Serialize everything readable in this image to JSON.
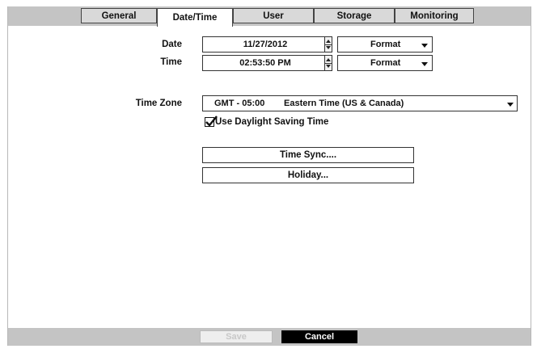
{
  "tabs": [
    {
      "label": "General",
      "active": false
    },
    {
      "label": "Date/Time",
      "active": true
    },
    {
      "label": "User",
      "active": false
    },
    {
      "label": "Storage",
      "active": false
    },
    {
      "label": "Monitoring",
      "active": false
    }
  ],
  "date": {
    "label": "Date",
    "value": "11/27/2012",
    "format_label": "Format"
  },
  "time": {
    "label": "Time",
    "value": "02:53:50 PM",
    "format_label": "Format"
  },
  "timezone": {
    "label": "Time Zone",
    "offset": "GMT - 05:00",
    "name": "Eastern Time (US & Canada)"
  },
  "dst": {
    "label": "Use Daylight Saving Time",
    "checked": true
  },
  "buttons": {
    "time_sync": "Time Sync....",
    "holiday": "Holiday..."
  },
  "footer": {
    "save": "Save",
    "cancel": "Cancel",
    "save_enabled": false
  },
  "colors": {
    "tabbar": "#c4c4c4",
    "cancel_bg": "#000000",
    "save_disabled_text": "#c8c8c8"
  },
  "icons": [
    "spinner-up-down-icon",
    "dropdown-caret-icon",
    "checkbox-check-icon"
  ]
}
